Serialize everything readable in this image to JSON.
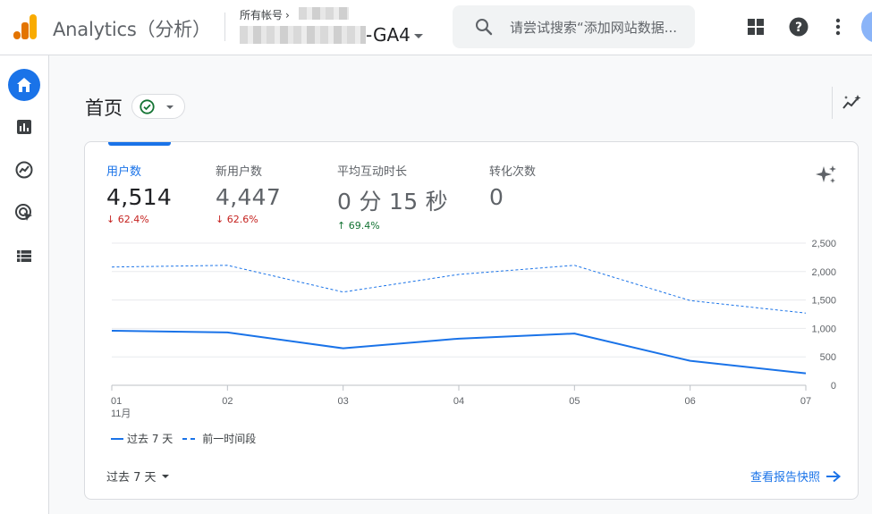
{
  "header": {
    "app_title": "Analytics（分析）",
    "account_crumb": "所有帐号",
    "property_name": "-GA4",
    "search_placeholder": "请尝试搜索“添加网站数据..."
  },
  "page": {
    "title": "首页"
  },
  "metrics": [
    {
      "label": "用户数",
      "value": "4,514",
      "change": "62.4%",
      "direction": "down",
      "active": true
    },
    {
      "label": "新用户数",
      "value": "4,447",
      "change": "62.6%",
      "direction": "down",
      "active": false
    },
    {
      "label": "平均互动时长",
      "value": "0 分 15 秒",
      "change": "69.4%",
      "direction": "up",
      "active": false
    },
    {
      "label": "转化次数",
      "value": "0",
      "change": "",
      "direction": "",
      "active": false
    }
  ],
  "chart_data": {
    "type": "line",
    "x": [
      "01",
      "02",
      "03",
      "04",
      "05",
      "06",
      "07"
    ],
    "x_sublabel": "11月",
    "y_ticks": [
      "2,500",
      "2,000",
      "1,500",
      "1,000",
      "500",
      "0"
    ],
    "ylim": [
      0,
      2500
    ],
    "series": [
      {
        "name": "过去 7 天",
        "style": "solid",
        "values": [
          960,
          930,
          650,
          820,
          910,
          430,
          210
        ]
      },
      {
        "name": "前一时间段",
        "style": "dashed",
        "values": [
          2080,
          2110,
          1640,
          1950,
          2110,
          1490,
          1270
        ]
      }
    ],
    "y_axis_side": "right",
    "grid": true,
    "legend_position": "bottom-left"
  },
  "footer": {
    "date_range": "过去 7 天",
    "view_snapshot": "查看报告快照"
  },
  "colors": {
    "accent": "#1a73e8",
    "down": "#c5221f",
    "up": "#137333"
  }
}
